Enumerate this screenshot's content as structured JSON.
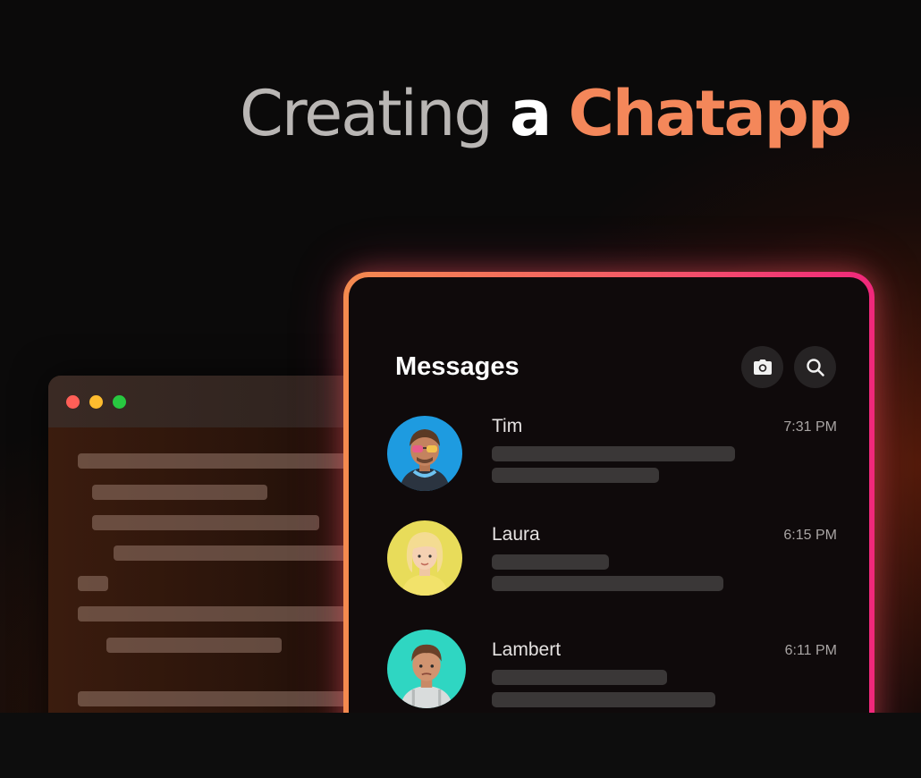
{
  "headline": {
    "part1": "Creating",
    "part2": "a",
    "part3": "Chatapp"
  },
  "editor": {
    "controls": [
      "close",
      "minimize",
      "maximize"
    ]
  },
  "messages": {
    "title": "Messages",
    "icons": [
      "camera-icon",
      "search-icon"
    ],
    "chats": [
      {
        "name": "Tim",
        "time": "7:31 PM",
        "avatar_color": "#1e9be0"
      },
      {
        "name": "Laura",
        "time": "6:15 PM",
        "avatar_color": "#e8dc5a"
      },
      {
        "name": "Lambert",
        "time": "6:11 PM",
        "avatar_color": "#2fd6c2"
      }
    ]
  },
  "colors": {
    "accent": "#f4875a",
    "border_start": "#f48a4f",
    "border_end": "#f0287b",
    "background": "#0b0a0a"
  }
}
